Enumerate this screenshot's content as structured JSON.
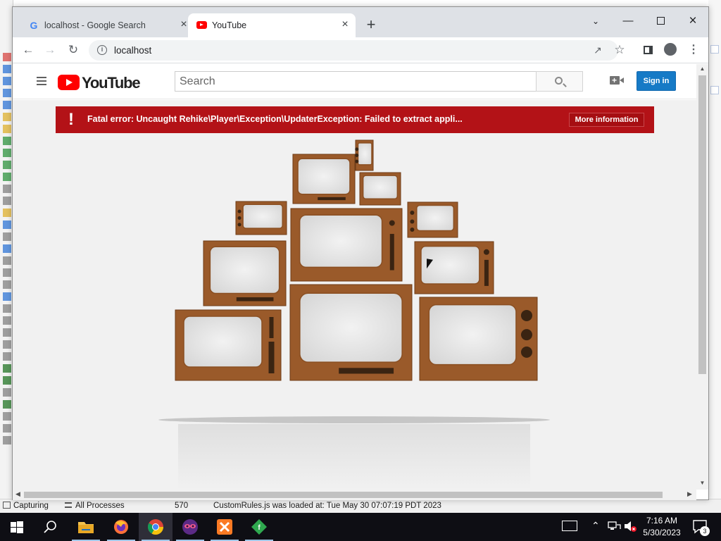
{
  "background_app": {
    "status_capturing": "Capturing",
    "status_processes": "All Processes",
    "status_count": "570",
    "status_message": "CustomRules.js was loaded at: Tue May 30 07:07:19 PDT 2023"
  },
  "browser": {
    "tabs": [
      {
        "title": "localhost - Google Search",
        "favicon": "google-g-icon"
      },
      {
        "title": "YouTube",
        "favicon": "youtube-icon",
        "active": true
      }
    ],
    "address": "localhost"
  },
  "youtube": {
    "logo_text": "YouTube",
    "search_placeholder": "Search",
    "sign_in_label": "Sign in",
    "error_message": "Fatal error: Uncaught Rehike\\Player\\Exception\\UpdaterException: Failed to extract appli...",
    "error_icon": "!",
    "more_info_label": "More information",
    "colors": {
      "brand_red": "#ff0000",
      "error_red": "#b31217",
      "signin_blue": "#167ac6",
      "tv_wood": "#9a5a2a"
    }
  },
  "taskbar": {
    "time": "7:16 AM",
    "date": "5/30/2023",
    "notification_count": "3",
    "apps": [
      "windows-start-icon",
      "search-icon",
      "file-explorer-icon",
      "firefox-icon",
      "chrome-icon",
      "masked-app-icon",
      "xampp-icon",
      "fiddler-icon"
    ]
  }
}
